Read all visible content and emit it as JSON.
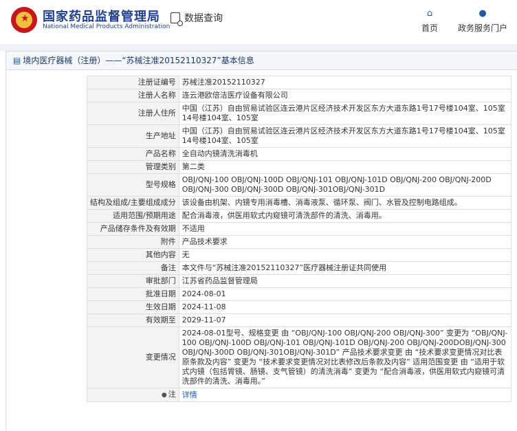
{
  "header": {
    "site_title_cn": "国家药品监督管理局",
    "site_title_en": "National Medical Products Administration",
    "search_label": "数据查询",
    "nav_home": "首页",
    "nav_service": "政务服务门户"
  },
  "breadcrumb": "境内医疗器械（注册）——“苏械注准20152110327”基本信息",
  "rows": [
    {
      "label": "注册证编号",
      "value": "苏械注准20152110327"
    },
    {
      "label": "注册人名称",
      "value": "连云港欧倍洁医疗设备有限公司"
    },
    {
      "label": "注册人住所",
      "value": "中国（江苏）自由贸易试验区连云港片区经济技术开发区东方大道东路1号17号楼104室、105室14号楼104室、105室"
    },
    {
      "label": "生产地址",
      "value": "中国（江苏）自由贸易试验区连云港片区经济技术开发区东方大道东路1号17号楼104室、105室14号楼104室、105室"
    },
    {
      "label": "产品名称",
      "value": "全自动内镜清洗消毒机"
    },
    {
      "label": "管理类别",
      "value": "第二类"
    },
    {
      "label": "型号规格",
      "value": "OBJ/QNJ-100 OBJ/QNJ-100D OBJ/QNJ-101 OBJ/QNJ-101D OBJ/QNJ-200 OBJ/QNJ-200D OBJ/QNJ-300 OBJ/QNJ-300D OBJ/QNJ-301OBJ/QNJ-301D"
    },
    {
      "label": "结构及组成/主要组成成分",
      "value": "该设备由机架、内镜专用消毒槽、消毒液泵、循环泵、阀门、水管及控制电路组成。"
    },
    {
      "label": "适用范围/预期用途",
      "value": "配合消毒液，供医用软式内窥镜可清洗部件的清洗、消毒用。"
    },
    {
      "label": "产品储存条件及有效期",
      "value": "不适用"
    },
    {
      "label": "附件",
      "value": "产品技术要求"
    },
    {
      "label": "其他内容",
      "value": "无"
    },
    {
      "label": "备注",
      "value": "本文件与“苏械注准20152110327”医疗器械注册证共同使用"
    },
    {
      "label": "审批部门",
      "value": "江苏省药品监督管理局"
    },
    {
      "label": "批准日期",
      "value": "2024-08-01"
    },
    {
      "label": "生效日期",
      "value": "2024-11-08"
    },
    {
      "label": "有效期至",
      "value": "2029-11-07"
    },
    {
      "label": "变更情况",
      "value": "2024-08-01型号、规格变更 由 “OBJ/QNJ-100 OBJ/QNJ-200 OBJ/QNJ-300” 变更为 “OBJ/QNJ-100 OBJ/QNJ-100D OBJ/QNJ-101 OBJ/QNJ-101D OBJ/QNJ-200 OBJ/QNJ-200DOBJ/QNJ-300 OBJ/QNJ-300D OBJ/QNJ-301OBJ/QNJ-301D” 产品技术要求变更 由 “技术要求变更情况对比表原条款及内容” 变更为 “技术要求变更情况对比表修改后条款及内容” 适用范围变更 由 “适用于软式内镜（包括胃镜、肠镜、支气管镜）的清洗消毒” 变更为 “配合消毒液，供医用软式内窥镜可清洗部件的清洗、消毒用。”"
    }
  ],
  "note": {
    "label": "注",
    "link": "详情"
  }
}
